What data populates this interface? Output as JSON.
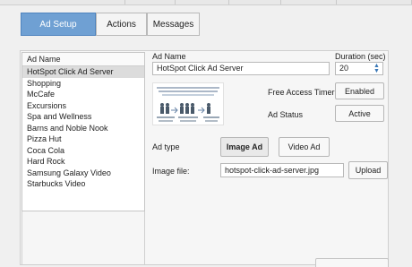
{
  "tabs": [
    {
      "label": "Ad Setup"
    },
    {
      "label": "Actions"
    },
    {
      "label": "Messages"
    }
  ],
  "ad_list": {
    "header": "Ad Name",
    "items": [
      "HotSpot Click Ad Server",
      "Shopping",
      "McCafe",
      "Excursions",
      "Spa and Wellness",
      "Barns and Noble Nook",
      "Pizza Hut",
      "Coca Cola",
      "Hard Rock",
      "Samsung Galaxy Video",
      "Starbucks Video"
    ],
    "selected_index": 0
  },
  "form": {
    "ad_name_label": "Ad Name",
    "ad_name_value": "HotSpot Click Ad Server",
    "duration_label": "Duration (sec)",
    "duration_value": "20",
    "free_access_label": "Free Access Timer",
    "free_access_button": "Enabled",
    "ad_status_label": "Ad Status",
    "ad_status_button": "Active",
    "ad_type_label": "Ad type",
    "image_ad_button": "Image Ad",
    "video_ad_button": "Video Ad",
    "image_file_label": "Image file:",
    "image_file_value": "hotspot-click-ad-server.jpg",
    "upload_button": "Upload"
  },
  "colors": {
    "active_tab": "#6fa0d3",
    "stepper_arrow": "#3a78b7"
  }
}
